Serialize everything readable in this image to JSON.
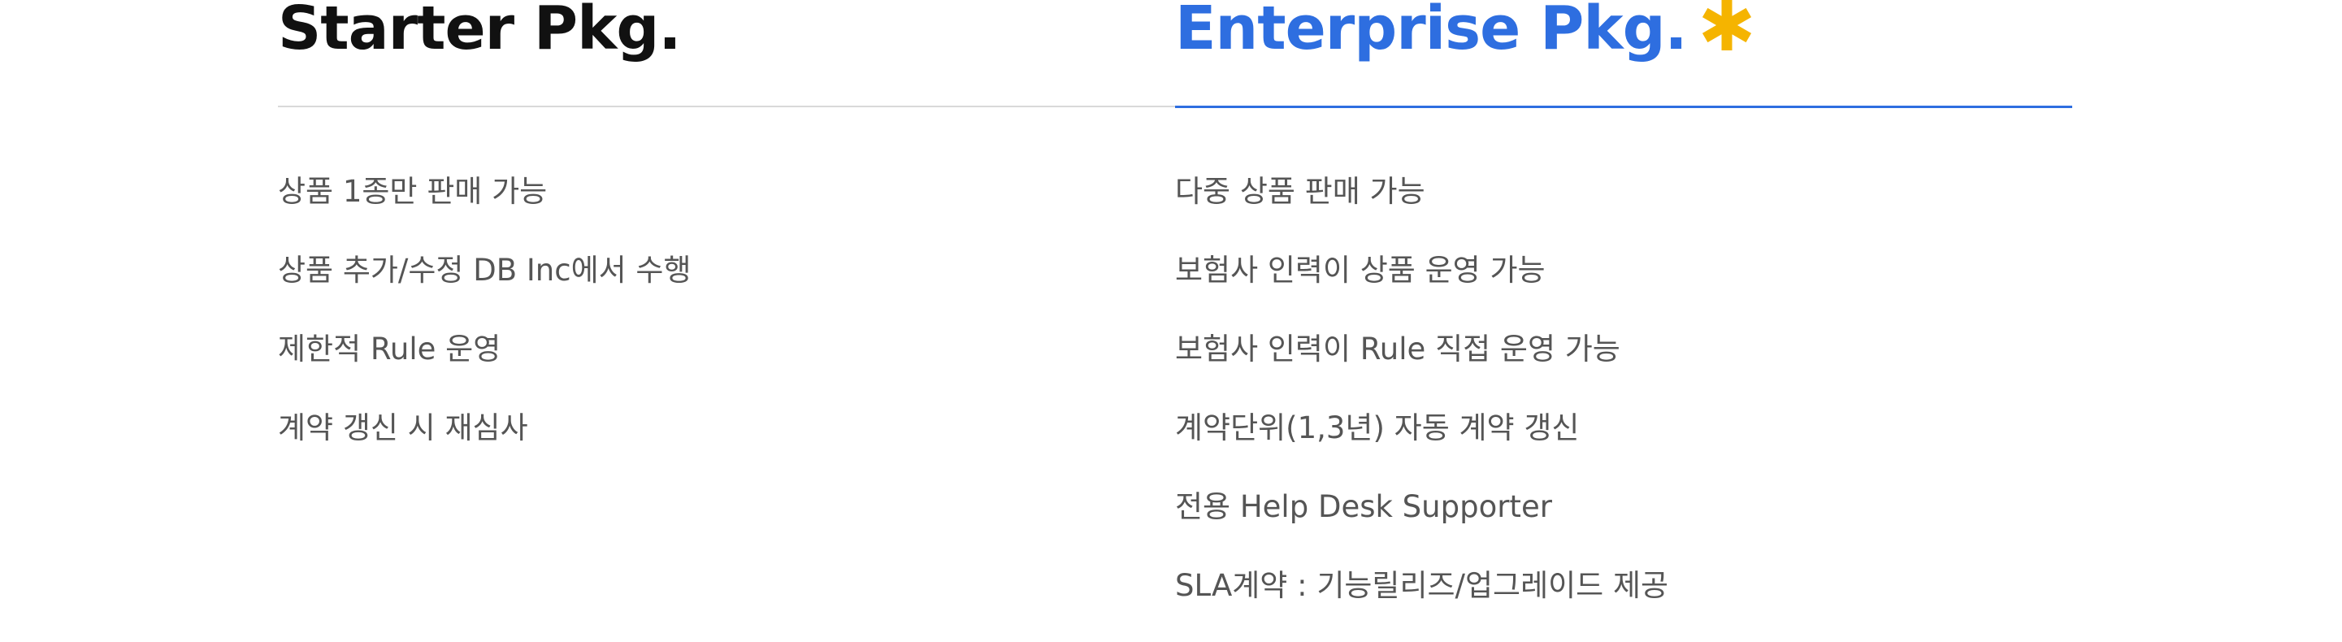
{
  "starter": {
    "title": "Starter Pkg.",
    "features": [
      "상품 1종만 판매 가능",
      "상품 추가/수정 DB Inc에서 수행",
      "제한적 Rule 운영",
      "계약 갱신 시 재심사"
    ]
  },
  "enterprise": {
    "title": "Enterprise Pkg.",
    "badge_icon": "asterisk-icon",
    "features": [
      "다중 상품 판매 가능",
      "보험사 인력이 상품 운영 가능",
      "보험사 인력이 Rule 직접 운영 가능",
      "계약단위(1,3년) 자동 계약 갱신",
      "전용 Help Desk Supporter",
      "SLA계약 : 기능릴리즈/업그레이드 제공"
    ]
  },
  "colors": {
    "starter_title": "#111111",
    "enterprise_accent": "#2e6ee0",
    "asterisk": "#f5b400",
    "feature_text": "#555555",
    "starter_divider": "#d9d9d9"
  }
}
